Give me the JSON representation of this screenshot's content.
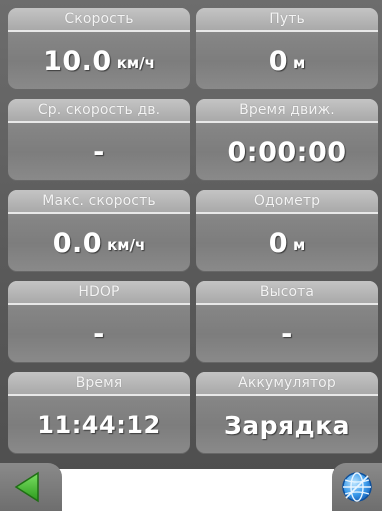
{
  "tiles": [
    {
      "label": "Скорость",
      "value": "10.0",
      "unit": "км/ч"
    },
    {
      "label": "Путь",
      "value": "0",
      "unit": "м"
    },
    {
      "label": "Ср. скорость дв.",
      "value": "-",
      "unit": ""
    },
    {
      "label": "Время движ.",
      "value": "0:00:00",
      "unit": ""
    },
    {
      "label": "Макс. скорость",
      "value": "0.0",
      "unit": "км/ч"
    },
    {
      "label": "Одометр",
      "value": "0",
      "unit": "м"
    },
    {
      "label": "HDOP",
      "value": "-",
      "unit": ""
    },
    {
      "label": "Высота",
      "value": "-",
      "unit": ""
    },
    {
      "label": "Время",
      "value": "11:44:12",
      "unit": ""
    },
    {
      "label": "Аккумулятор",
      "value": "Зарядка",
      "unit": ""
    }
  ],
  "toolbar": {
    "back_icon": "back-arrow-icon",
    "globe_icon": "globe-icon",
    "accent_green": "#3fae2a",
    "accent_blue": "#1e78d8"
  }
}
